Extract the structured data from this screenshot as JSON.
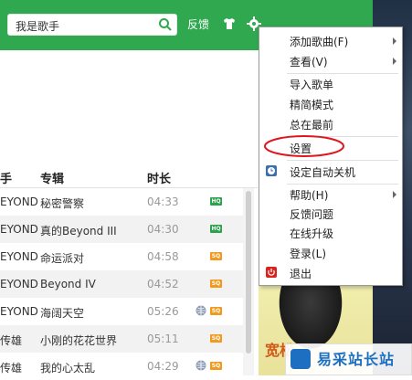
{
  "search": {
    "value": "我是歌手"
  },
  "toolbar": {
    "feedback_label": "反馈",
    "icons": [
      "search-icon",
      "shirt-icon",
      "gear-icon"
    ]
  },
  "list": {
    "headers": {
      "artist": "手",
      "album": "专辑",
      "time": "时长"
    },
    "rows": [
      {
        "artist": "EYOND",
        "album": "秘密警察",
        "time": "04:33",
        "quality": "HQ",
        "globe": false
      },
      {
        "artist": "EYOND",
        "album": "真的Beyond III",
        "time": "04:30",
        "quality": "HQ",
        "globe": false
      },
      {
        "artist": "EYOND",
        "album": "命运派对",
        "time": "04:58",
        "quality": "SQ",
        "globe": false
      },
      {
        "artist": "EYOND",
        "album": "Beyond IV",
        "time": "04:52",
        "quality": "SQ",
        "globe": false
      },
      {
        "artist": "EYOND",
        "album": "海阔天空",
        "time": "05:26",
        "quality": "SQ",
        "globe": true
      },
      {
        "artist": "传雄",
        "album": "小刚的花花世界",
        "time": "05:11",
        "quality": "SQ",
        "globe": false
      },
      {
        "artist": "传雄",
        "album": "我的心太乱",
        "time": "04:29",
        "quality": "SQ",
        "globe": true
      }
    ]
  },
  "menu": {
    "items": [
      {
        "label": "添加歌曲(F)",
        "submenu": true
      },
      {
        "label": "查看(V)",
        "submenu": true
      },
      {
        "label": "导入歌单",
        "submenu": false
      },
      {
        "label": "精简模式",
        "submenu": false
      },
      {
        "label": "总在最前",
        "submenu": false
      },
      {
        "label": "设置",
        "submenu": false
      },
      {
        "label": "设定自动关机",
        "submenu": false,
        "icon": "clock-icon"
      },
      {
        "label": "帮助(H)",
        "submenu": true
      },
      {
        "label": "反馈问题",
        "submenu": false
      },
      {
        "label": "在线升级",
        "submenu": false
      },
      {
        "label": "登录(L)",
        "submenu": false
      },
      {
        "label": "退出",
        "submenu": false,
        "icon": "power-icon"
      }
    ]
  },
  "promo": {
    "side_text": "宽松",
    "brand": "易采站长站"
  },
  "colors": {
    "accent": "#2fa84f",
    "highlight": "#e0161e",
    "hq": "#2aa34a",
    "sq": "#f29a1e"
  }
}
